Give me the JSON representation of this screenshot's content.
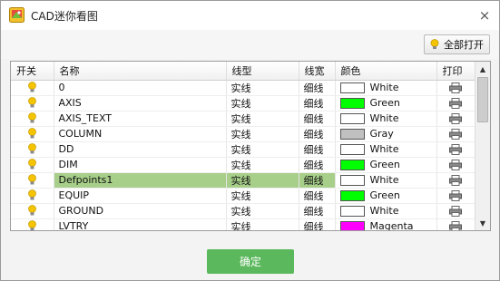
{
  "window": {
    "title": "CAD迷你看图",
    "close_glyph": "×"
  },
  "toolbar": {
    "open_all_label": "全部打开"
  },
  "columns": [
    "开关",
    "名称",
    "线型",
    "线宽",
    "颜色",
    "打印"
  ],
  "layers": [
    {
      "name": "0",
      "linetype": "实线",
      "lineweight": "细线",
      "color_name": "White",
      "color_hex": "#ffffff"
    },
    {
      "name": "AXIS",
      "linetype": "实线",
      "lineweight": "细线",
      "color_name": "Green",
      "color_hex": "#00ff00"
    },
    {
      "name": "AXIS_TEXT",
      "linetype": "实线",
      "lineweight": "细线",
      "color_name": "White",
      "color_hex": "#ffffff"
    },
    {
      "name": "COLUMN",
      "linetype": "实线",
      "lineweight": "细线",
      "color_name": "Gray",
      "color_hex": "#c0c0c0"
    },
    {
      "name": "DD",
      "linetype": "实线",
      "lineweight": "细线",
      "color_name": "White",
      "color_hex": "#ffffff"
    },
    {
      "name": "DIM",
      "linetype": "实线",
      "lineweight": "细线",
      "color_name": "Green",
      "color_hex": "#00ff00"
    },
    {
      "name": "Defpoints1",
      "linetype": "实线",
      "lineweight": "细线",
      "color_name": "White",
      "color_hex": "#ffffff"
    },
    {
      "name": "EQUIP",
      "linetype": "实线",
      "lineweight": "细线",
      "color_name": "Green",
      "color_hex": "#00ff00"
    },
    {
      "name": "GROUND",
      "linetype": "实线",
      "lineweight": "细线",
      "color_name": "White",
      "color_hex": "#ffffff"
    },
    {
      "name": "LVTRY",
      "linetype": "实线",
      "lineweight": "细线",
      "color_name": "Magenta",
      "color_hex": "#ff00ff"
    }
  ],
  "selected_row": 6,
  "footer": {
    "ok_label": "确定"
  },
  "colors": {
    "accent": "#5cb85c",
    "selection": "#a8cf8a",
    "bulb": "#f5c400"
  }
}
